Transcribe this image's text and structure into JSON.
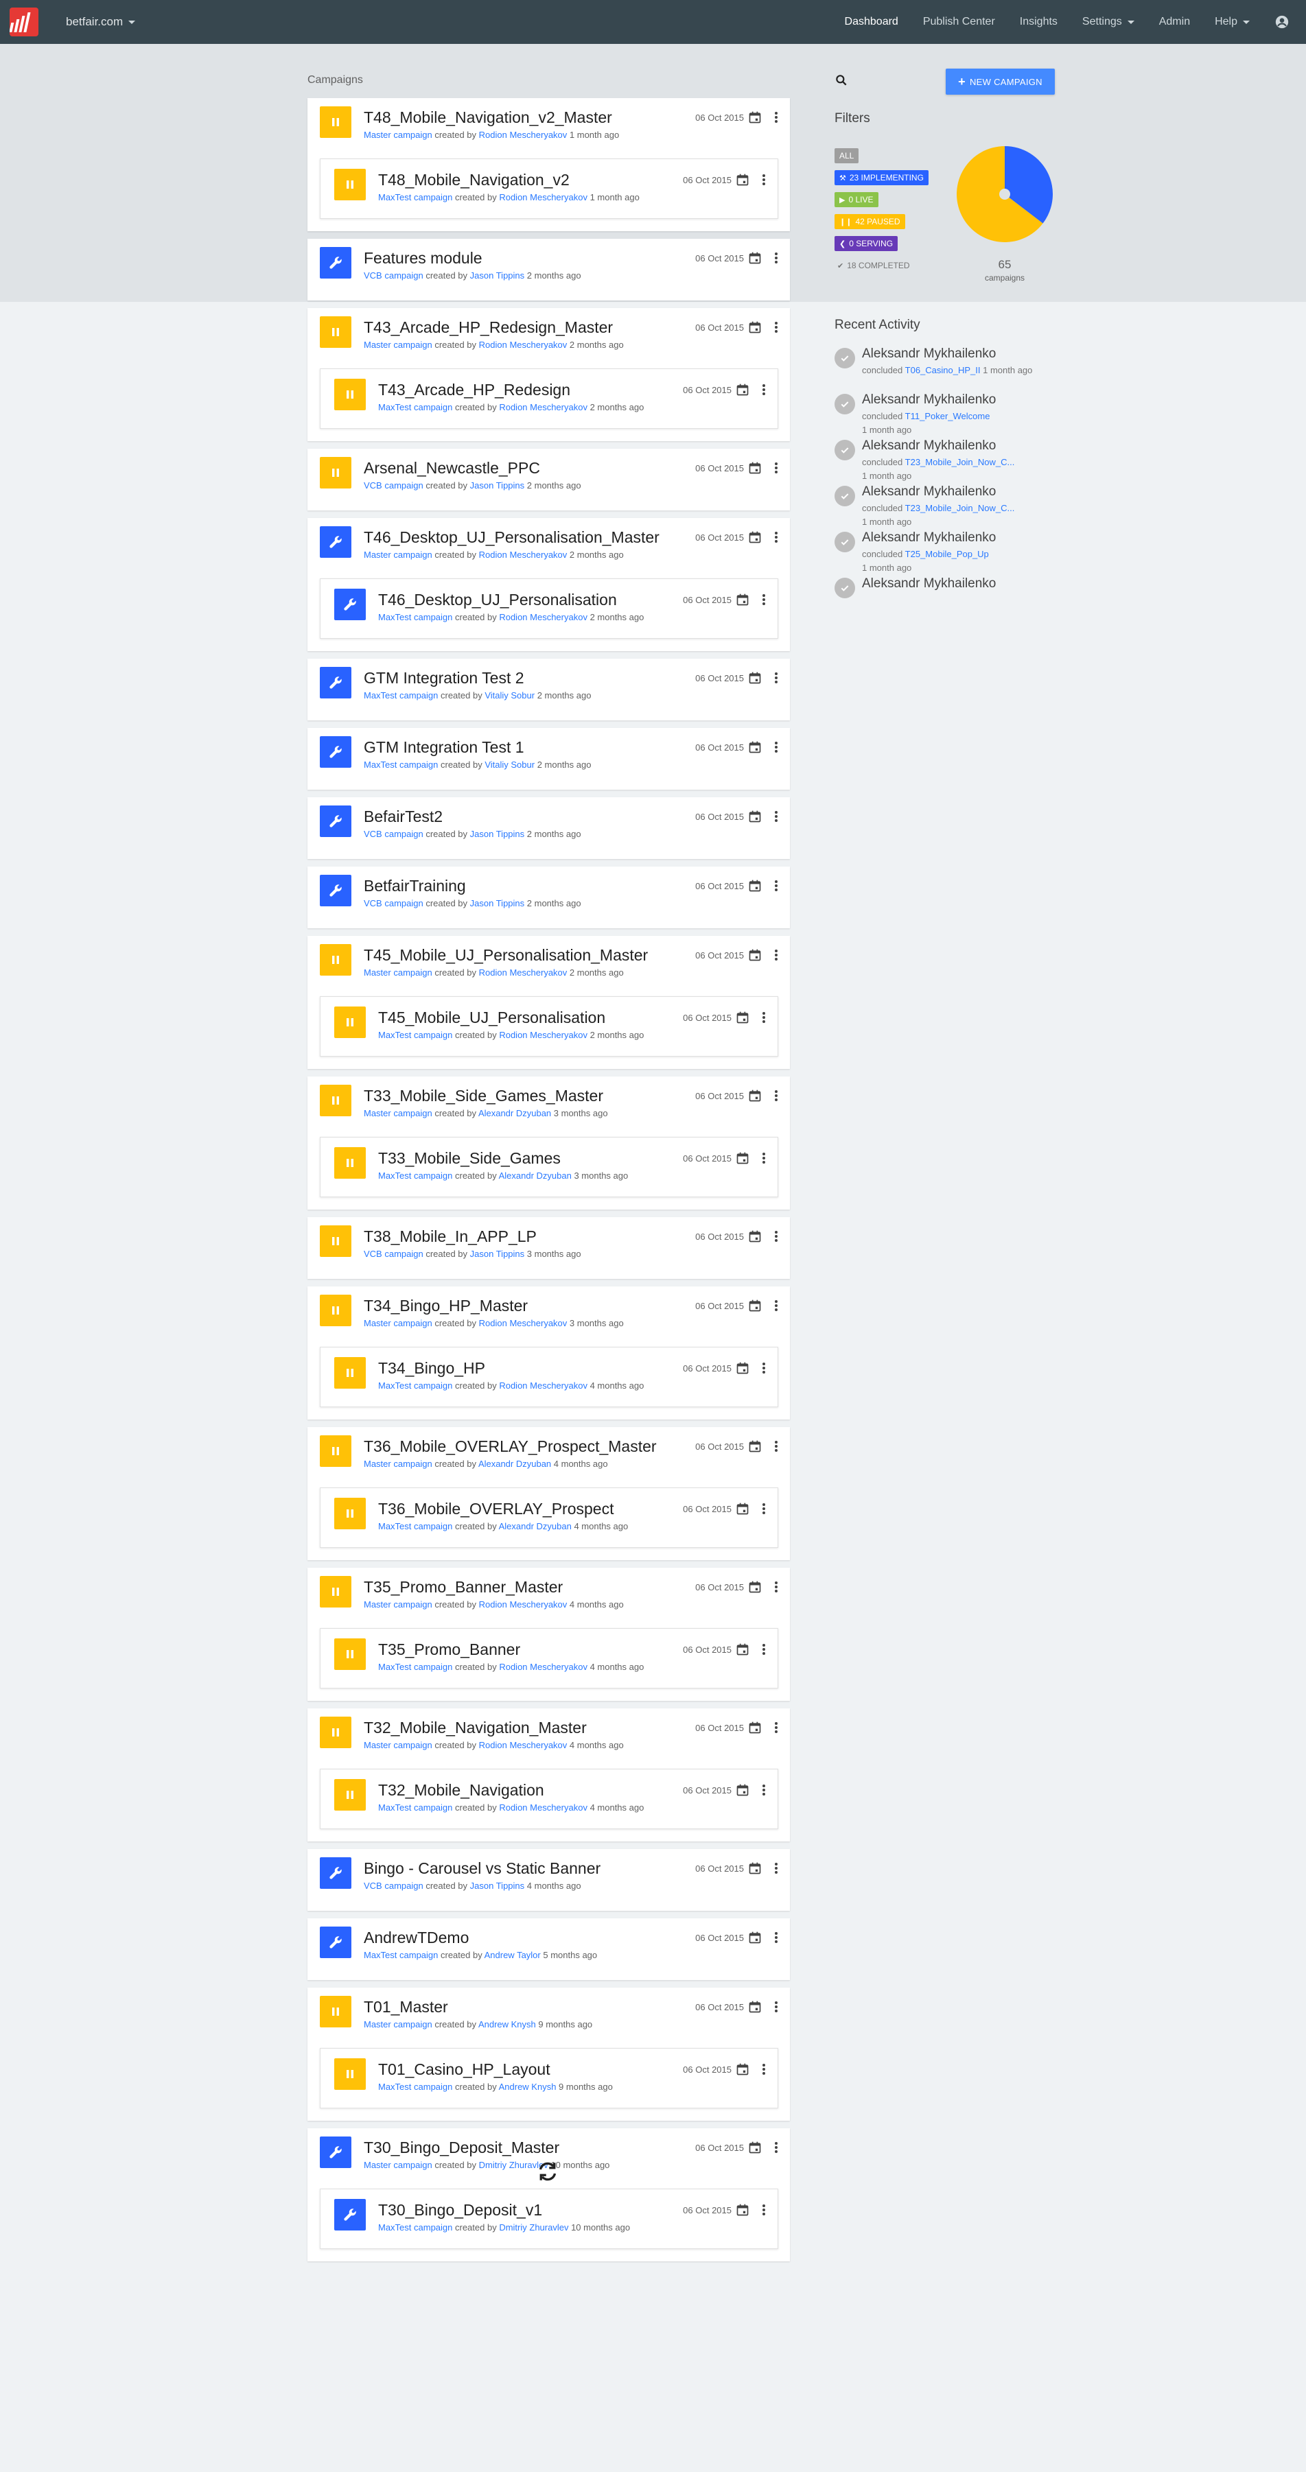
{
  "nav": {
    "brand": "betfair.com",
    "links": [
      "Dashboard",
      "Publish Center",
      "Insights",
      "Settings",
      "Admin",
      "Help"
    ]
  },
  "campaigns_heading": "Campaigns",
  "campaigns": [
    {
      "name": "T48_Mobile_Navigation_v2_Master",
      "status": "paused",
      "type": "Master campaign",
      "author": "Rodion Mescheryakov",
      "ago": "1 month ago",
      "date": "06 Oct 2015",
      "children": [
        {
          "name": "T48_Mobile_Navigation_v2",
          "status": "paused",
          "type": "MaxTest campaign",
          "author": "Rodion Mescheryakov",
          "ago": "1 month ago",
          "date": "06 Oct 2015"
        }
      ]
    },
    {
      "name": "Features module",
      "status": "implementing",
      "type": "VCB campaign",
      "author": "Jason Tippins",
      "ago": "2 months ago",
      "date": "06 Oct 2015",
      "children": []
    },
    {
      "name": "T43_Arcade_HP_Redesign_Master",
      "status": "paused",
      "type": "Master campaign",
      "author": "Rodion Mescheryakov",
      "ago": "2 months ago",
      "date": "06 Oct 2015",
      "children": [
        {
          "name": "T43_Arcade_HP_Redesign",
          "status": "paused",
          "type": "MaxTest campaign",
          "author": "Rodion Mescheryakov",
          "ago": "2 months ago",
          "date": "06 Oct 2015"
        }
      ]
    },
    {
      "name": "Arsenal_Newcastle_PPC",
      "status": "paused",
      "type": "VCB campaign",
      "author": "Jason Tippins",
      "ago": "2 months ago",
      "date": "06 Oct 2015",
      "children": []
    },
    {
      "name": "T46_Desktop_UJ_Personalisation_Master",
      "status": "implementing",
      "type": "Master campaign",
      "author": "Rodion Mescheryakov",
      "ago": "2 months ago",
      "date": "06 Oct 2015",
      "children": [
        {
          "name": "T46_Desktop_UJ_Personalisation",
          "status": "implementing",
          "type": "MaxTest campaign",
          "author": "Rodion Mescheryakov",
          "ago": "2 months ago",
          "date": "06 Oct 2015"
        }
      ]
    },
    {
      "name": "GTM Integration Test 2",
      "status": "implementing",
      "type": "MaxTest campaign",
      "author": "Vitaliy Sobur",
      "ago": "2 months ago",
      "date": "06 Oct 2015",
      "children": []
    },
    {
      "name": "GTM Integration Test 1",
      "status": "implementing",
      "type": "MaxTest campaign",
      "author": "Vitaliy Sobur",
      "ago": "2 months ago",
      "date": "06 Oct 2015",
      "children": []
    },
    {
      "name": "BefairTest2",
      "status": "implementing",
      "type": "VCB campaign",
      "author": "Jason Tippins",
      "ago": "2 months ago",
      "date": "06 Oct 2015",
      "children": []
    },
    {
      "name": "BetfairTraining",
      "status": "implementing",
      "type": "VCB campaign",
      "author": "Jason Tippins",
      "ago": "2 months ago",
      "date": "06 Oct 2015",
      "children": []
    },
    {
      "name": "T45_Mobile_UJ_Personalisation_Master",
      "status": "paused",
      "type": "Master campaign",
      "author": "Rodion Mescheryakov",
      "ago": "2 months ago",
      "date": "06 Oct 2015",
      "children": [
        {
          "name": "T45_Mobile_UJ_Personalisation",
          "status": "paused",
          "type": "MaxTest campaign",
          "author": "Rodion Mescheryakov",
          "ago": "2 months ago",
          "date": "06 Oct 2015"
        }
      ]
    },
    {
      "name": "T33_Mobile_Side_Games_Master",
      "status": "paused",
      "type": "Master campaign",
      "author": "Alexandr Dzyuban",
      "ago": "3 months ago",
      "date": "06 Oct 2015",
      "children": [
        {
          "name": "T33_Mobile_Side_Games",
          "status": "paused",
          "type": "MaxTest campaign",
          "author": "Alexandr Dzyuban",
          "ago": "3 months ago",
          "date": "06 Oct 2015"
        }
      ]
    },
    {
      "name": "T38_Mobile_In_APP_LP",
      "status": "paused",
      "type": "VCB campaign",
      "author": "Jason Tippins",
      "ago": "3 months ago",
      "date": "06 Oct 2015",
      "children": []
    },
    {
      "name": "T34_Bingo_HP_Master",
      "status": "paused",
      "type": "Master campaign",
      "author": "Rodion Mescheryakov",
      "ago": "3 months ago",
      "date": "06 Oct 2015",
      "children": [
        {
          "name": "T34_Bingo_HP",
          "status": "paused",
          "type": "MaxTest campaign",
          "author": "Rodion Mescheryakov",
          "ago": "4 months ago",
          "date": "06 Oct 2015"
        }
      ]
    },
    {
      "name": "T36_Mobile_OVERLAY_Prospect_Master",
      "status": "paused",
      "type": "Master campaign",
      "author": "Alexandr Dzyuban",
      "ago": "4 months ago",
      "date": "06 Oct 2015",
      "children": [
        {
          "name": "T36_Mobile_OVERLAY_Prospect",
          "status": "paused",
          "type": "MaxTest campaign",
          "author": "Alexandr Dzyuban",
          "ago": "4 months ago",
          "date": "06 Oct 2015"
        }
      ]
    },
    {
      "name": "T35_Promo_Banner_Master",
      "status": "paused",
      "type": "Master campaign",
      "author": "Rodion Mescheryakov",
      "ago": "4 months ago",
      "date": "06 Oct 2015",
      "children": [
        {
          "name": "T35_Promo_Banner",
          "status": "paused",
          "type": "MaxTest campaign",
          "author": "Rodion Mescheryakov",
          "ago": "4 months ago",
          "date": "06 Oct 2015"
        }
      ]
    },
    {
      "name": "T32_Mobile_Navigation_Master",
      "status": "paused",
      "type": "Master campaign",
      "author": "Rodion Mescheryakov",
      "ago": "4 months ago",
      "date": "06 Oct 2015",
      "children": [
        {
          "name": "T32_Mobile_Navigation",
          "status": "paused",
          "type": "MaxTest campaign",
          "author": "Rodion Mescheryakov",
          "ago": "4 months ago",
          "date": "06 Oct 2015"
        }
      ]
    },
    {
      "name": "Bingo - Carousel vs Static Banner",
      "status": "implementing",
      "type": "VCB campaign",
      "author": "Jason Tippins",
      "ago": "4 months ago",
      "date": "06 Oct 2015",
      "children": []
    },
    {
      "name": "AndrewTDemo",
      "status": "implementing",
      "type": "MaxTest campaign",
      "author": "Andrew Taylor",
      "ago": "5 months ago",
      "date": "06 Oct 2015",
      "children": []
    },
    {
      "name": "T01_Master",
      "status": "paused",
      "type": "Master campaign",
      "author": "Andrew Knysh",
      "ago": "9 months ago",
      "date": "06 Oct 2015",
      "children": [
        {
          "name": "T01_Casino_HP_Layout",
          "status": "paused",
          "type": "MaxTest campaign",
          "author": "Andrew Knysh",
          "ago": "9 months ago",
          "date": "06 Oct 2015"
        }
      ]
    },
    {
      "name": "T30_Bingo_Deposit_Master",
      "status": "implementing",
      "type": "Master campaign",
      "author": "Dmitriy Zhuravlev",
      "ago": "10 months ago",
      "date": "06 Oct 2015",
      "children": [
        {
          "name": "T30_Bingo_Deposit_v1",
          "status": "implementing",
          "type": "MaxTest campaign",
          "author": "Dmitriy Zhuravlev",
          "ago": "10 months ago",
          "date": "06 Oct 2015"
        }
      ]
    }
  ],
  "created_by_text": "created by",
  "new_campaign_label": "NEW CAMPAIGN",
  "filters_title": "Filters",
  "filters": [
    {
      "key": "all",
      "label": "ALL",
      "icon": ""
    },
    {
      "key": "impl",
      "label": "23 IMPLEMENTING",
      "icon": "wrench-icon"
    },
    {
      "key": "live",
      "label": "0 LIVE",
      "icon": "play-icon"
    },
    {
      "key": "paused",
      "label": "42 PAUSED",
      "icon": "pause-icon"
    },
    {
      "key": "serving",
      "label": "0 SERVING",
      "icon": "share-icon"
    },
    {
      "key": "completed",
      "label": "18 COMPLETED",
      "icon": "check-icon"
    }
  ],
  "chart_data": {
    "type": "pie",
    "slices": [
      {
        "name": "paused",
        "value": 42,
        "color": "#ffc107"
      },
      {
        "name": "implementing",
        "value": 23,
        "color": "#2962ff"
      }
    ]
  },
  "pie_total": "65",
  "pie_label": "campaigns",
  "recent_title": "Recent Activity",
  "activities": [
    {
      "name": "Aleksandr Mykhailenko",
      "verb": "concluded",
      "target": "T06_Casino_HP_II",
      "time": "1 month ago",
      "time_inline": true
    },
    {
      "name": "Aleksandr Mykhailenko",
      "verb": "concluded",
      "target": "T11_Poker_Welcome",
      "time": "1 month ago",
      "time_inline": false
    },
    {
      "name": "Aleksandr Mykhailenko",
      "verb": "concluded",
      "target": "T23_Mobile_Join_Now_C...",
      "time": "1 month ago",
      "time_inline": false
    },
    {
      "name": "Aleksandr Mykhailenko",
      "verb": "concluded",
      "target": "T23_Mobile_Join_Now_C...",
      "time": "1 month ago",
      "time_inline": false
    },
    {
      "name": "Aleksandr Mykhailenko",
      "verb": "concluded",
      "target": "T25_Mobile_Pop_Up",
      "time": "1 month ago",
      "time_inline": false
    },
    {
      "name": "Aleksandr Mykhailenko",
      "verb": "concluded",
      "target": "",
      "time": "",
      "time_inline": false
    }
  ],
  "colors": {
    "navbar": "#37474f",
    "band": "#dfe3e6",
    "background": "#eff2f4",
    "paused": "#ffc107",
    "implementing": "#2962ff",
    "link": "#2979ff",
    "button": "#448aff"
  }
}
